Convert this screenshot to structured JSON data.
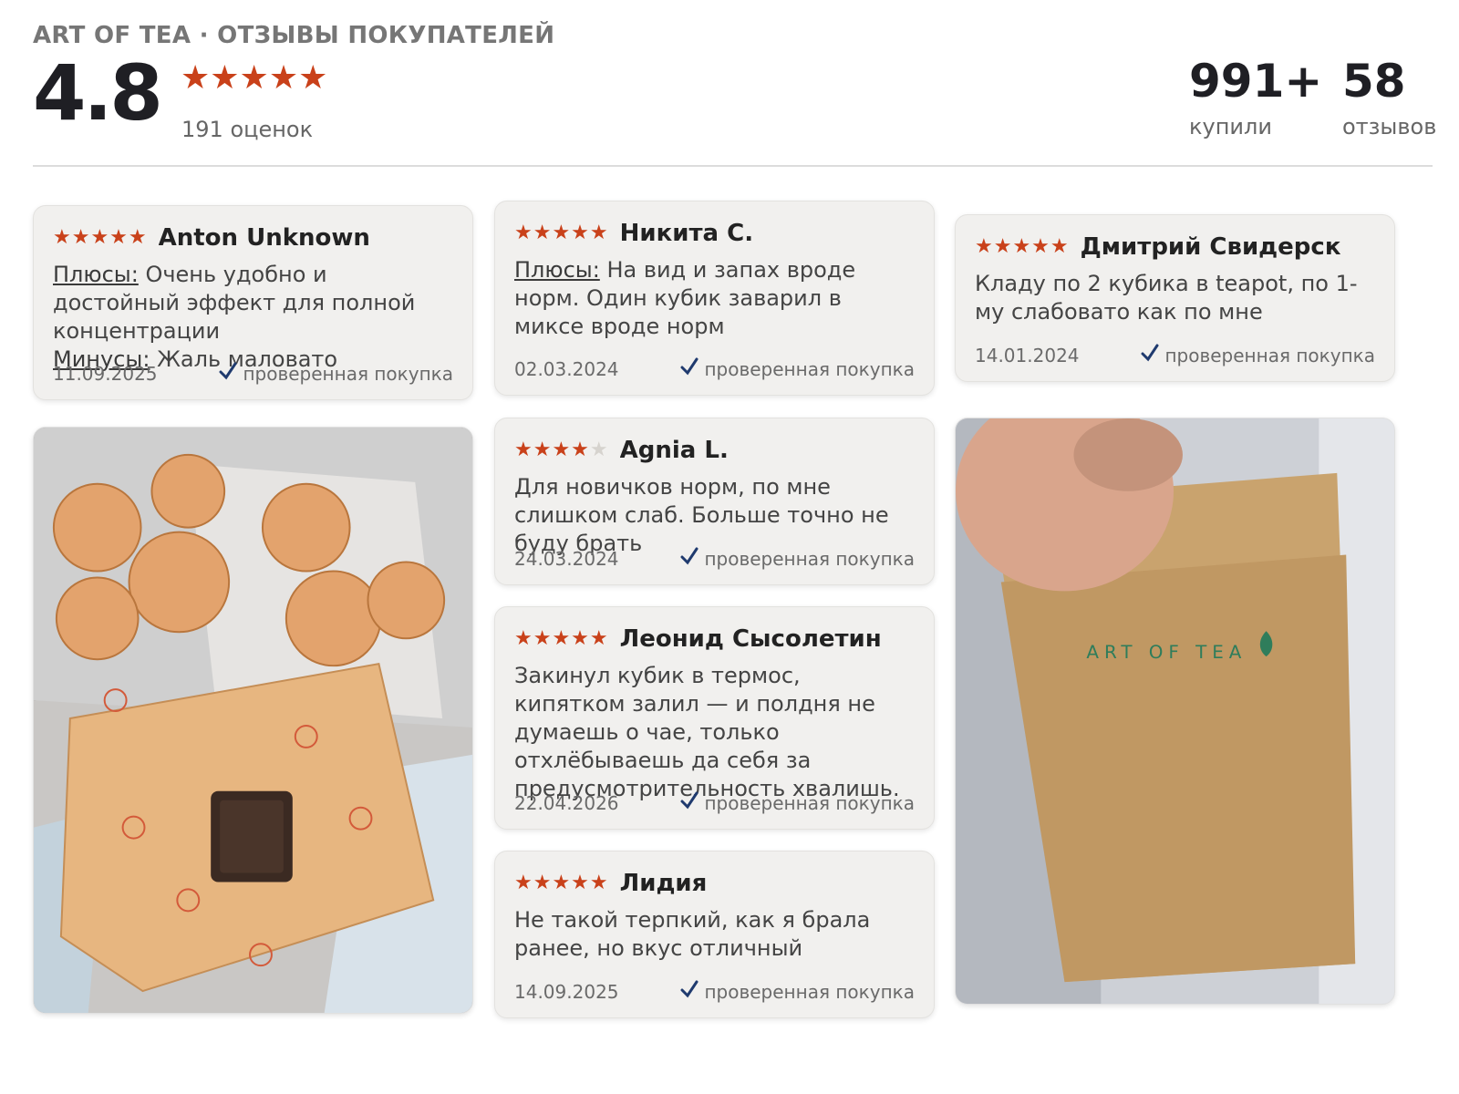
{
  "header": {
    "brand_title": "ART OF TEA · ОТЗЫВЫ ПОКУПАТЕЛЕЙ",
    "score": "4.8",
    "stars": "★★★★★",
    "ratings_count": "191 оценок",
    "stats": [
      {
        "value": "991+",
        "label": "купили"
      },
      {
        "value": "58",
        "label": "отзывов"
      }
    ]
  },
  "reviews": [
    {
      "author": "Anton Unknown",
      "stars": "★★★★★",
      "rating": 5,
      "pros_label": "Плюсы:",
      "pros": " Очень удобно и достойный эффект для полной концентрации",
      "cons_label": "Минусы:",
      "cons": " Жаль маловато",
      "date": "11.09.2025",
      "verified": "проверенная покупка"
    },
    {
      "author": "Никита С.",
      "stars": "★★★★★",
      "rating": 5,
      "pros_label": "Плюсы:",
      "pros": " На вид и запах вроде норм. Один кубик заварил в миксе вроде норм",
      "date": "02.03.2024",
      "verified": "проверенная покупка"
    },
    {
      "author": "Дмитрий Свидерск",
      "stars": "★★★★★",
      "rating": 5,
      "text": "Кладу по 2 кубика в teapot, по 1-му слабовато как по мне",
      "date": "14.01.2024",
      "verified": "проверенная покупка"
    },
    {
      "author": "Agnia L.",
      "stars_on": "★★★★",
      "stars_off": "★",
      "rating": 4,
      "text": "Для новичков норм, по мне слишком слаб. Больше точно не буду брать",
      "date": "24.03.2024",
      "verified": "проверенная покупка"
    },
    {
      "author": "Леонид Сысолетин",
      "stars": "★★★★★",
      "rating": 5,
      "text": "Закинул кубик в термос, кипятком залил — и полдня не думаешь о чае, только отхлёбываешь да себя за предусмотрительность хвалишь.",
      "date": "22.04.2026",
      "verified": "проверенная покупка"
    },
    {
      "author": "Лидия",
      "stars": "★★★★★",
      "rating": 5,
      "text": "Не такой терпкий, как я брала ранее, но вкус отличный",
      "date": "14.09.2025",
      "verified": "проверенная покупка"
    }
  ],
  "photos": {
    "bag_brand": "ART OF TEA"
  },
  "colors": {
    "star": "#c9411a",
    "card_bg": "#f1f0ee",
    "check": "#1f3a6e"
  }
}
